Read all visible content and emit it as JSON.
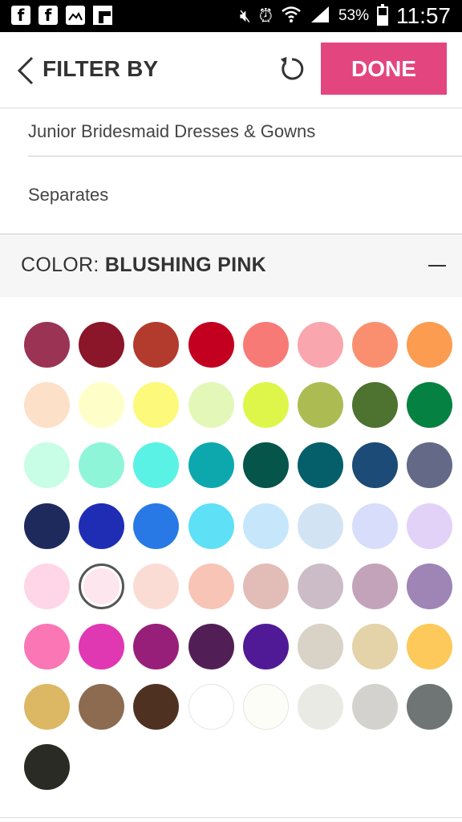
{
  "status_bar": {
    "battery_percent": "53%",
    "battery_level": 0.53,
    "time": "11:57",
    "left_icons": [
      "facebook-icon",
      "facebook-icon",
      "gallery-icon",
      "flipboard-icon"
    ],
    "right_icons": [
      "mute-icon",
      "alarm-icon",
      "wifi-icon",
      "signal-icon"
    ]
  },
  "header": {
    "title": "FILTER BY",
    "done_label": "DONE",
    "done_color": "#e3457f"
  },
  "list": {
    "items": [
      "Junior Bridesmaid Dresses & Gowns",
      "Separates"
    ]
  },
  "color_filter": {
    "label_prefix": "COLOR: ",
    "selected_name": "BLUSHING PINK",
    "selected_index": 33,
    "swatches": [
      "#9b3355",
      "#8b1529",
      "#b23b2e",
      "#c3001f",
      "#f87a77",
      "#f9a6ae",
      "#fa8f70",
      "#fb9c50",
      "#fde0c8",
      "#feffc8",
      "#fdf97a",
      "#e3f8b8",
      "#def64a",
      "#acbc52",
      "#4e7230",
      "#058142",
      "#c8fde6",
      "#8ff5d9",
      "#5af2e4",
      "#0da8ae",
      "#06554a",
      "#045f6b",
      "#1b4b76",
      "#636987",
      "#1f2a5c",
      "#1f2db5",
      "#2879e6",
      "#5ee0f6",
      "#c6e7fb",
      "#d2e4f4",
      "#d8ddfc",
      "#e3d2f7",
      "#fed6e7",
      "#fde6ee",
      "#fbdcd5",
      "#f7c4b5",
      "#e2bcb6",
      "#cbbcc7",
      "#c3a3b9",
      "#9f84b6",
      "#fa76b5",
      "#e037b2",
      "#981f79",
      "#511f55",
      "#501a97",
      "#d8d3c6",
      "#e4d2a8",
      "#fcc95a",
      "#dcb764",
      "#8c6b51",
      "#4f3122",
      "#ffffff",
      "#fdfdf8",
      "#eaeae5",
      "#d3d2ce",
      "#6f7474",
      "#2b2b25"
    ]
  }
}
